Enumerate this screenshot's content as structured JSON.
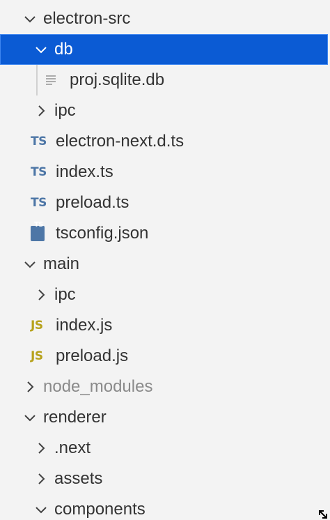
{
  "explorer": {
    "rows": [
      {
        "label": "electron-src",
        "kind": "folder-open"
      },
      {
        "label": "db",
        "kind": "folder-open",
        "selected": true
      },
      {
        "label": "proj.sqlite.db",
        "kind": "file-db"
      },
      {
        "label": "ipc",
        "kind": "folder-closed"
      },
      {
        "label": "electron-next.d.ts",
        "kind": "ts"
      },
      {
        "label": "index.ts",
        "kind": "ts"
      },
      {
        "label": "preload.ts",
        "kind": "ts"
      },
      {
        "label": "tsconfig.json",
        "kind": "tsconfig"
      },
      {
        "label": "main",
        "kind": "folder-open"
      },
      {
        "label": "ipc",
        "kind": "folder-closed"
      },
      {
        "label": "index.js",
        "kind": "js"
      },
      {
        "label": "preload.js",
        "kind": "js"
      },
      {
        "label": "node_modules",
        "kind": "folder-closed",
        "ignored": true
      },
      {
        "label": "renderer",
        "kind": "folder-open"
      },
      {
        "label": ".next",
        "kind": "folder-closed"
      },
      {
        "label": "assets",
        "kind": "folder-closed"
      },
      {
        "label": "components",
        "kind": "folder-open"
      }
    ],
    "icons": {
      "ts_badge": "TS",
      "js_badge": "JS",
      "tsconfig_badge": "TS"
    },
    "colors": {
      "selection_bg": "#0b5bd4",
      "ts_icon": "#4d76a6",
      "js_icon": "#b7a21c",
      "ignored_text": "#8a8a8a"
    }
  }
}
